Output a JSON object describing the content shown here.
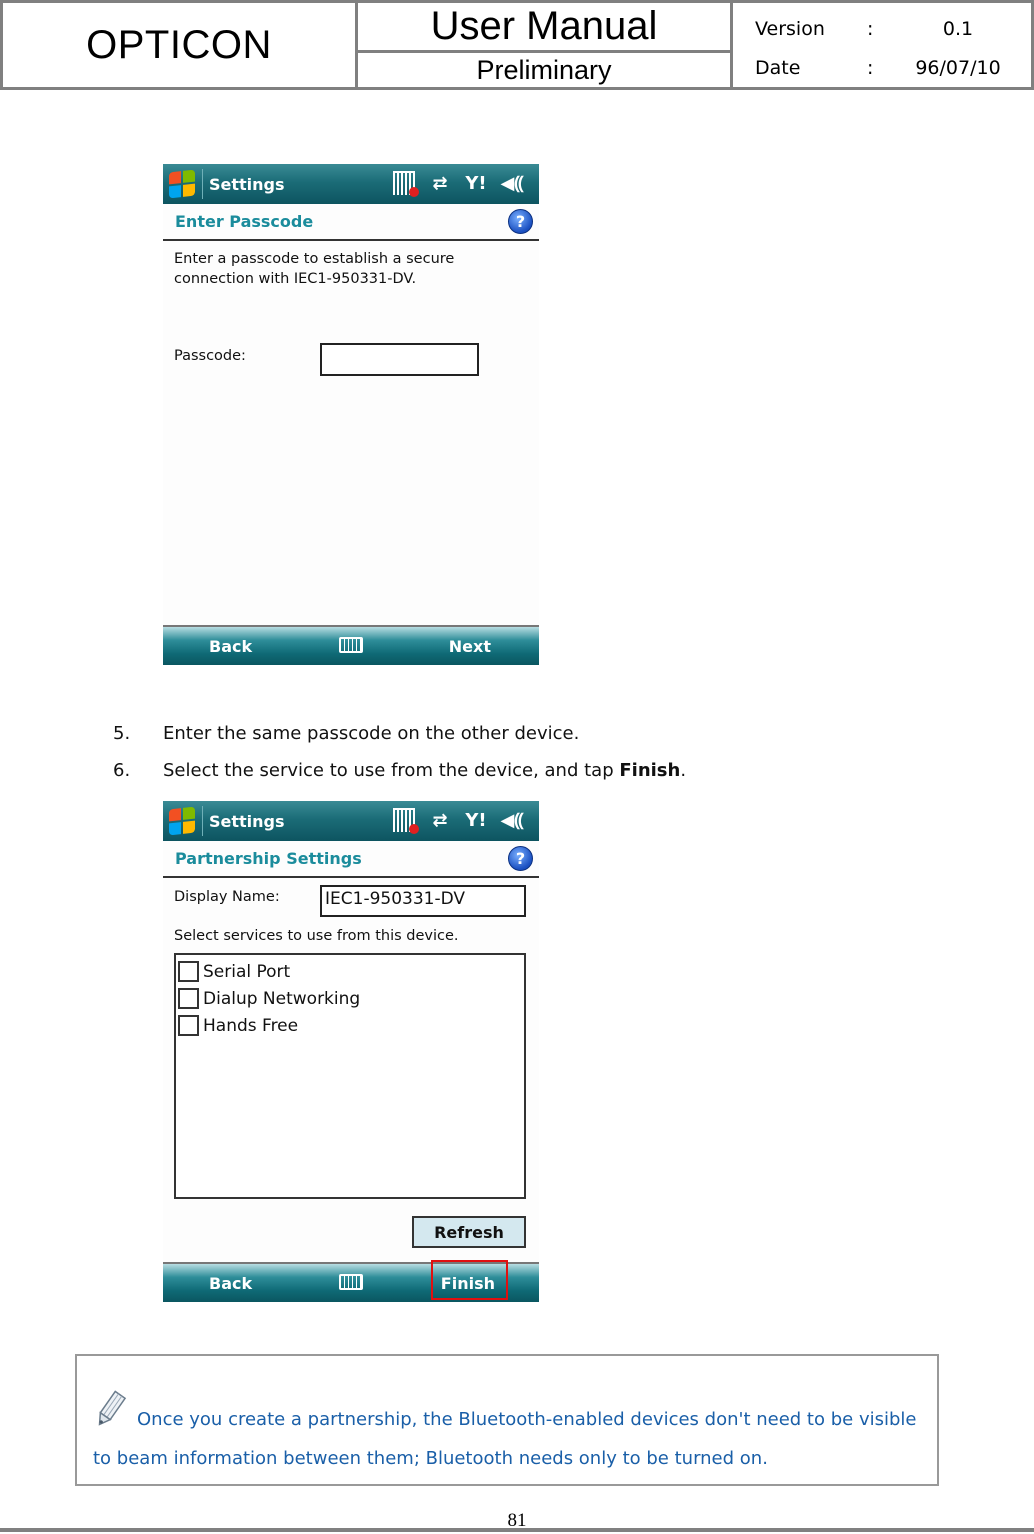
{
  "header": {
    "brand": "OPTICON",
    "title": "User Manual",
    "subtitle": "Preliminary",
    "version_label": "Version",
    "version_sep": ":",
    "version_value": "0.1",
    "date_label": "Date",
    "date_sep": ":",
    "date_value": "96/07/10"
  },
  "screen1": {
    "titlebar": {
      "title": "Settings",
      "icons": [
        "windows-start-icon",
        "barcode-scanner-off-icon",
        "connectivity-icon",
        "signal-alert-icon",
        "volume-icon"
      ]
    },
    "section_title": "Enter Passcode",
    "help_glyph": "?",
    "body_text": "Enter a passcode to establish a secure connection with IEC1-950331-DV.",
    "passcode_label": "Passcode:",
    "passcode_value": "",
    "softkeys": {
      "left": "Back",
      "right": "Next",
      "center_icon": "keyboard-icon"
    }
  },
  "steps": [
    {
      "num": "5.",
      "text": "Enter the same passcode on the other device.",
      "bold": "",
      "suffix": ""
    },
    {
      "num": "6.",
      "text": "Select the service to use from the device, and tap ",
      "bold": "Finish",
      "suffix": "."
    }
  ],
  "screen2": {
    "titlebar": {
      "title": "Settings"
    },
    "section_title": "Partnership Settings",
    "help_glyph": "?",
    "display_name_label": "Display Name:",
    "display_name_value": "IEC1-950331-DV",
    "services_prompt": "Select services to use from this device.",
    "services": [
      {
        "label": "Serial Port",
        "checked": false
      },
      {
        "label": "Dialup Networking",
        "checked": false
      },
      {
        "label": "Hands Free",
        "checked": false
      }
    ],
    "refresh_label": "Refresh",
    "softkeys": {
      "left": "Back",
      "right": "Finish",
      "center_icon": "keyboard-icon"
    },
    "highlight_color": "#e01010"
  },
  "note": {
    "icon": "pencil-icon",
    "line1": "Once you create a partnership, the Bluetooth-enabled devices don't need to be visible",
    "line2": "to beam information between them; Bluetooth needs only to be turned on.",
    "color": "#1a5fa8"
  },
  "footer": {
    "page_number": "81"
  }
}
